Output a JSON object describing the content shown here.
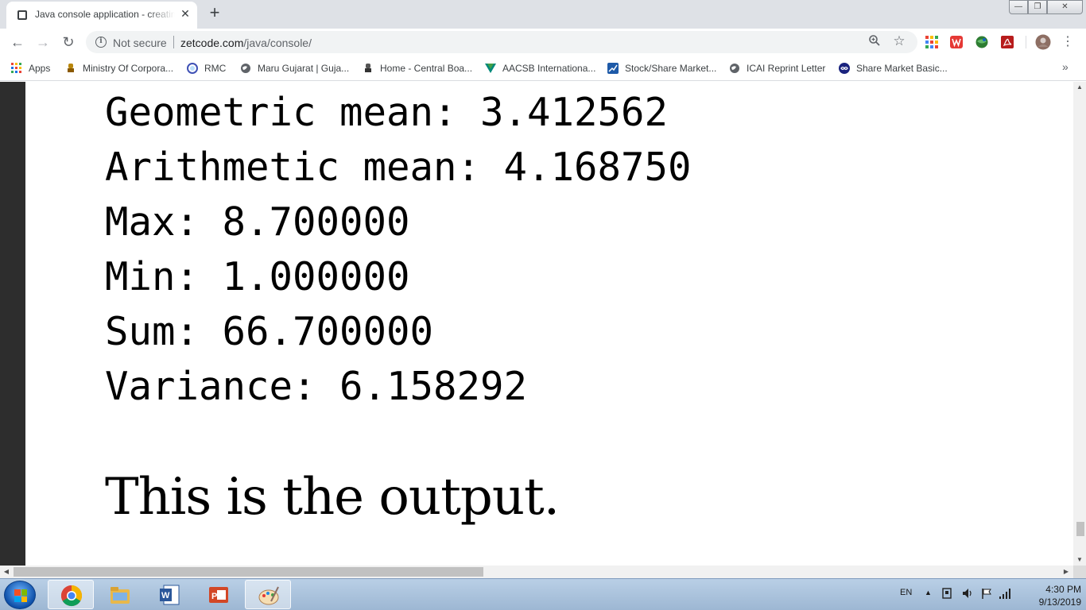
{
  "tab": {
    "title": "Java console application - creating",
    "close_glyph": "✕",
    "new_tab_glyph": "+"
  },
  "window_controls": {
    "minimize": "—",
    "maximize": "❐",
    "close": "✕"
  },
  "toolbar": {
    "back_glyph": "←",
    "forward_glyph": "→",
    "reload_glyph": "↻",
    "security_label": "Not secure",
    "url_domain": "zetcode.com",
    "url_path": "/java/console/",
    "menu_glyph": "⋮"
  },
  "bookmarks": [
    {
      "label": "Apps",
      "icon": "apps-grid-icon"
    },
    {
      "label": "Ministry Of Corpora...",
      "icon": "emblem-icon"
    },
    {
      "label": "RMC",
      "icon": "rmc-circle-icon"
    },
    {
      "label": "Maru Gujarat | Guja...",
      "icon": "globe-icon"
    },
    {
      "label": "Home - Central Boa...",
      "icon": "emblem-icon"
    },
    {
      "label": "AACSB Internationa...",
      "icon": "aacsb-icon"
    },
    {
      "label": "Stock/Share Market...",
      "icon": "chart-icon"
    },
    {
      "label": "ICAI Reprint Letter",
      "icon": "globe-icon"
    },
    {
      "label": "Share Market Basic...",
      "icon": "infinity-icon"
    }
  ],
  "bookmarks_more": "»",
  "content": {
    "console_lines": [
      "Geometric mean: 3.412562",
      "Arithmetic mean: 4.168750",
      "Max: 8.700000",
      "Min: 1.000000",
      "Sum: 66.700000",
      "Variance: 6.158292"
    ],
    "output_text": "This is the output."
  },
  "taskbar": {
    "language": "EN",
    "time": "4:30 PM",
    "date": "9/13/2019"
  },
  "colors": {
    "tabstrip": "#dee1e6",
    "omnibox": "#f1f3f4",
    "page_background": "#ffffff",
    "left_sidebar": "#2d2d2d",
    "taskbar": "#a9c2dd"
  }
}
